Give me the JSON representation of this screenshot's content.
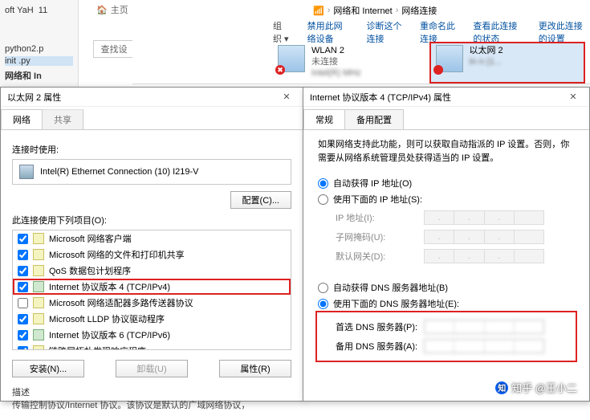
{
  "left": {
    "items": [
      "oft YaH",
      "11",
      "python2.p",
      "init .py"
    ],
    "section": "网络和 In",
    "home": "主页",
    "search": "查找设"
  },
  "breadcrumb": {
    "lvl1": "网络和 Internet",
    "lvl2": "网络连接"
  },
  "toolbar": {
    "org": "组织 ▾",
    "a": "禁用此网络设备",
    "b": "诊断这个连接",
    "c": "重命名此连接",
    "d": "查看此连接的状态",
    "e": "更改此连接的设置"
  },
  "adapters": {
    "wlan": {
      "name": "WLAN 2",
      "status": "未连接",
      "desc": "Intel(R)                 MHz"
    },
    "eth": {
      "name": "以太网 2",
      "status": " ",
      "desc": "In                                   n (1..."
    }
  },
  "dlg1": {
    "title": "以太网 2 属性",
    "tabs": {
      "a": "网络",
      "b": "共享"
    },
    "connect_using": "连接时使用:",
    "nic": "Intel(R) Ethernet Connection (10) I219-V",
    "configure": "配置(C)...",
    "uses_items": "此连接使用下列项目(O):",
    "items": [
      {
        "label": "Microsoft 网络客户端",
        "checked": true,
        "icon": "y"
      },
      {
        "label": "Microsoft 网络的文件和打印机共享",
        "checked": true,
        "icon": "y"
      },
      {
        "label": "QoS 数据包计划程序",
        "checked": true,
        "icon": "y"
      },
      {
        "label": "Internet 协议版本 4 (TCP/IPv4)",
        "checked": true,
        "icon": "g",
        "hl": true
      },
      {
        "label": "Microsoft 网络适配器多路传送器协议",
        "checked": false,
        "icon": "y"
      },
      {
        "label": "Microsoft LLDP 协议驱动程序",
        "checked": true,
        "icon": "y"
      },
      {
        "label": "Internet 协议版本 6 (TCP/IPv6)",
        "checked": true,
        "icon": "g"
      },
      {
        "label": "链路层拓扑发现响应程序",
        "checked": true,
        "icon": "y"
      }
    ],
    "install": "安装(N)...",
    "uninstall": "卸载(U)",
    "props": "属性(R)",
    "desc_label": "描述",
    "desc_text": "传输控制协议/Internet 协议。该协议是默认的广域网络协议，"
  },
  "dlg2": {
    "title": "Internet 协议版本 4 (TCP/IPv4) 属性",
    "tabs": {
      "a": "常规",
      "b": "备用配置"
    },
    "info": "如果网络支持此功能，则可以获取自动指派的 IP 设置。否则，你需要从网络系统管理员处获得适当的 IP 设置。",
    "r_auto_ip": "自动获得 IP 地址(O)",
    "r_man_ip": "使用下面的 IP 地址(S):",
    "ip_label": "IP 地址(I):",
    "mask_label": "子网掩码(U):",
    "gw_label": "默认网关(D):",
    "r_auto_dns": "自动获得 DNS 服务器地址(B)",
    "r_man_dns": "使用下面的 DNS 服务器地址(E):",
    "dns1_label": "首选 DNS 服务器(P):",
    "dns2_label": "备用 DNS 服务器(A):"
  },
  "watermark": "知乎 @王小二"
}
